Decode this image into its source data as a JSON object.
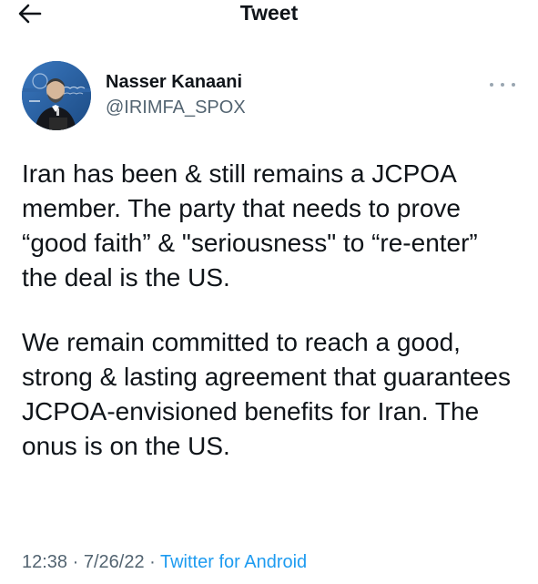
{
  "header": {
    "title": "Tweet",
    "back_icon": "arrow-left-icon"
  },
  "author": {
    "name": "Nasser Kanaani",
    "handle": "@IRIMFA_SPOX",
    "avatar_icon": "profile-photo"
  },
  "more_icon": "ellipsis-icon",
  "tweet": {
    "paragraph_1": "Iran has been & still remains a JCPOA member. The party that needs to prove “good faith” & \"seriousness\" to “re-enter” the deal is the US.",
    "paragraph_2": "We remain committed to reach a good, strong & lasting agreement that guarantees JCPOA-envisioned benefits for Iran. The onus is on the US."
  },
  "meta": {
    "time": "12:38",
    "separator": " · ",
    "date": "7/26/22",
    "source": "Twitter for Android"
  },
  "colors": {
    "text": "#0f1419",
    "secondary": "#536471",
    "accent": "#1d9bf0"
  }
}
